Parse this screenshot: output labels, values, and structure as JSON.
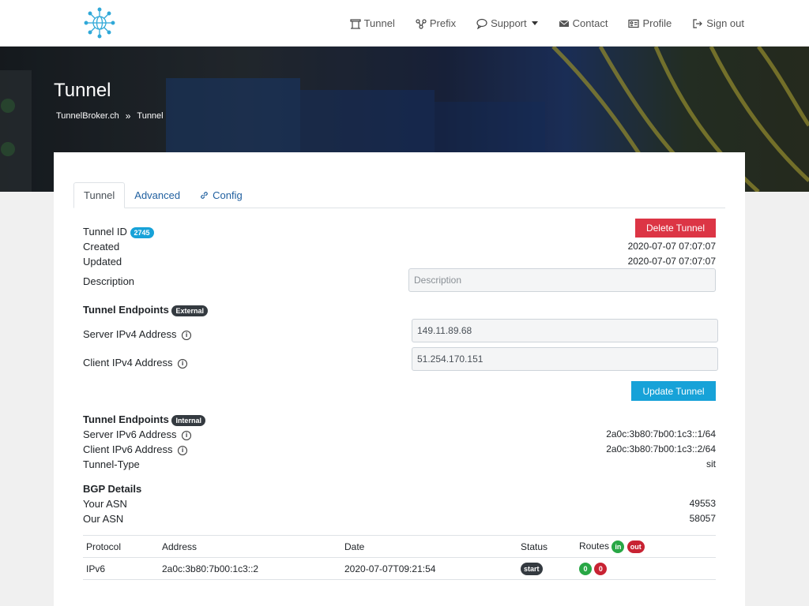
{
  "nav": {
    "items": [
      {
        "label": "Tunnel",
        "icon": "tunnel-icon"
      },
      {
        "label": "Prefix",
        "icon": "network-icon"
      },
      {
        "label": "Support",
        "icon": "chat-icon",
        "dropdown": true
      },
      {
        "label": "Contact",
        "icon": "envelope-icon"
      },
      {
        "label": "Profile",
        "icon": "id-card-icon"
      },
      {
        "label": "Sign out",
        "icon": "sign-out-icon"
      }
    ]
  },
  "hero": {
    "title": "Tunnel",
    "breadcrumb": [
      "TunnelBroker.ch",
      "Tunnel"
    ]
  },
  "tabs": [
    {
      "label": "Tunnel",
      "active": true
    },
    {
      "label": "Advanced",
      "active": false
    },
    {
      "label": "Config",
      "active": false,
      "icon": "link-icon"
    }
  ],
  "info": {
    "tunnel_id_label": "Tunnel ID",
    "tunnel_id": "2745",
    "delete_button": "Delete Tunnel",
    "created_label": "Created",
    "created": "2020-07-07 07:07:07",
    "updated_label": "Updated",
    "updated": "2020-07-07 07:07:07",
    "description_label": "Description",
    "description_placeholder": "Description"
  },
  "external": {
    "heading": "Tunnel Endpoints",
    "badge": "External",
    "server_label": "Server IPv4 Address",
    "server_value": "149.11.89.68",
    "client_label": "Client IPv4 Address",
    "client_value": "51.254.170.151",
    "update_button": "Update Tunnel"
  },
  "internal": {
    "heading": "Tunnel Endpoints",
    "badge": "Internal",
    "server_label": "Server IPv6 Address",
    "server_value": "2a0c:3b80:7b00:1c3::1/64",
    "client_label": "Client IPv6 Address",
    "client_value": "2a0c:3b80:7b00:1c3::2/64",
    "type_label": "Tunnel-Type",
    "type_value": "sit"
  },
  "bgp": {
    "heading": "BGP Details",
    "your_asn_label": "Your ASN",
    "your_asn": "49553",
    "our_asn_label": "Our ASN",
    "our_asn": "58057",
    "table": {
      "headers": {
        "protocol": "Protocol",
        "address": "Address",
        "date": "Date",
        "status": "Status",
        "routes": "Routes",
        "in": "in",
        "out": "out"
      },
      "rows": [
        {
          "protocol": "IPv6",
          "address": "2a0c:3b80:7b00:1c3::2",
          "date": "2020-07-07T09:21:54",
          "status": "start",
          "routes_in": "0",
          "routes_out": "0"
        }
      ]
    }
  }
}
